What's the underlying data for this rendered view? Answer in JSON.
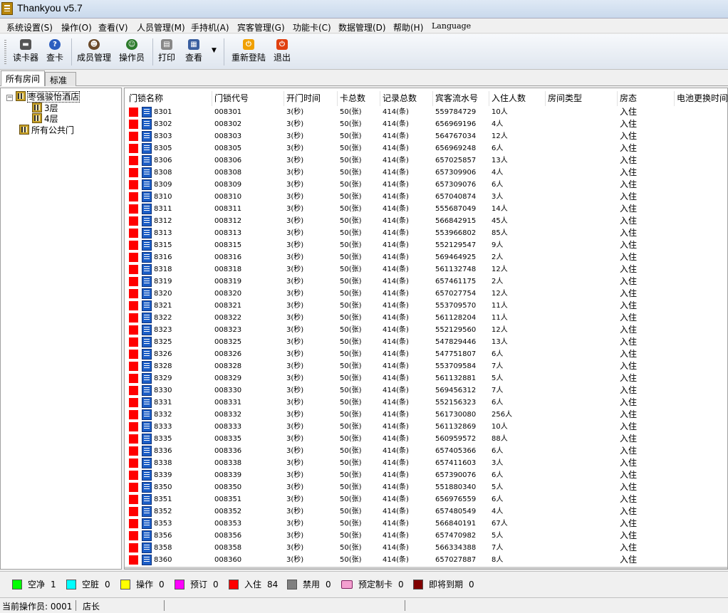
{
  "window": {
    "title": "Thankyou v5.7"
  },
  "menu": [
    "系统设置(S)",
    "操作(O)",
    "查看(V)",
    "人员管理(M)",
    "手持机(A)",
    "宾客管理(G)",
    "功能卡(C)",
    "数据管理(D)",
    "帮助(H)",
    "Language"
  ],
  "toolbar": {
    "read_card": "读卡器",
    "check_card": "查卡",
    "member_mgmt": "成员管理",
    "operator": "操作员",
    "print": "打印",
    "view": "查看",
    "relogin": "重新登陆",
    "exit": "退出"
  },
  "tabs": [
    "所有房间",
    "标准"
  ],
  "tree": {
    "hotel": "枣强骏怡酒店",
    "floor3": "3层",
    "floor4": "4层",
    "public": "所有公共门",
    "toggle": "−"
  },
  "grid": {
    "columns": [
      "门锁名称",
      "门锁代号",
      "开门时间",
      "卡总数",
      "记录总数",
      "宾客流水号",
      "入住人数",
      "房间类型",
      "房态",
      "电池更换时间"
    ],
    "open_time": "3(秒)",
    "card_total": "50(张)",
    "record_total": "414(条)",
    "room_status": "入住",
    "rows": [
      [
        "8301",
        "008301",
        "559784729",
        "10人"
      ],
      [
        "8302",
        "008302",
        "656969196",
        "4人"
      ],
      [
        "8303",
        "008303",
        "564767034",
        "12人"
      ],
      [
        "8305",
        "008305",
        "656969248",
        "6人"
      ],
      [
        "8306",
        "008306",
        "657025857",
        "13人"
      ],
      [
        "8308",
        "008308",
        "657309906",
        "4人"
      ],
      [
        "8309",
        "008309",
        "657309076",
        "6人"
      ],
      [
        "8310",
        "008310",
        "657040874",
        "3人"
      ],
      [
        "8311",
        "008311",
        "555687049",
        "14人"
      ],
      [
        "8312",
        "008312",
        "566842915",
        "45人"
      ],
      [
        "8313",
        "008313",
        "553966802",
        "85人"
      ],
      [
        "8315",
        "008315",
        "552129547",
        "9人"
      ],
      [
        "8316",
        "008316",
        "569464925",
        "2人"
      ],
      [
        "8318",
        "008318",
        "561132748",
        "12人"
      ],
      [
        "8319",
        "008319",
        "657461175",
        "2人"
      ],
      [
        "8320",
        "008320",
        "657027754",
        "12人"
      ],
      [
        "8321",
        "008321",
        "553709570",
        "11人"
      ],
      [
        "8322",
        "008322",
        "561128204",
        "11人"
      ],
      [
        "8323",
        "008323",
        "552129560",
        "12人"
      ],
      [
        "8325",
        "008325",
        "547829446",
        "13人"
      ],
      [
        "8326",
        "008326",
        "547751807",
        "6人"
      ],
      [
        "8328",
        "008328",
        "553709584",
        "7人"
      ],
      [
        "8329",
        "008329",
        "561132881",
        "5人"
      ],
      [
        "8330",
        "008330",
        "569456312",
        "7人"
      ],
      [
        "8331",
        "008331",
        "552156323",
        "6人"
      ],
      [
        "8332",
        "008332",
        "561730080",
        "256人"
      ],
      [
        "8333",
        "008333",
        "561132869",
        "10人"
      ],
      [
        "8335",
        "008335",
        "560959572",
        "88人"
      ],
      [
        "8336",
        "008336",
        "657405366",
        "6人"
      ],
      [
        "8338",
        "008338",
        "657411603",
        "3人"
      ],
      [
        "8339",
        "008339",
        "657390076",
        "6人"
      ],
      [
        "8350",
        "008350",
        "551880340",
        "5人"
      ],
      [
        "8351",
        "008351",
        "656976559",
        "6人"
      ],
      [
        "8352",
        "008352",
        "657480549",
        "4人"
      ],
      [
        "8353",
        "008353",
        "566840191",
        "67人"
      ],
      [
        "8356",
        "008356",
        "657470982",
        "5人"
      ],
      [
        "8358",
        "008358",
        "566334388",
        "7人"
      ],
      [
        "8360",
        "008360",
        "657027887",
        "8人"
      ]
    ]
  },
  "legend": [
    {
      "label": "空净",
      "count": "1",
      "color": "#00ff00"
    },
    {
      "label": "空脏",
      "count": "0",
      "color": "#00ffff"
    },
    {
      "label": "操作",
      "count": "0",
      "color": "#ffff00"
    },
    {
      "label": "预订",
      "count": "0",
      "color": "#ff00ff"
    },
    {
      "label": "入住",
      "count": "84",
      "color": "#ff0000"
    },
    {
      "label": "禁用",
      "count": "0",
      "color": "#808080"
    },
    {
      "label": "预定制卡",
      "count": "0",
      "color": "card"
    },
    {
      "label": "即将到期",
      "count": "0",
      "color": "#800000"
    }
  ],
  "status": {
    "operator": "当前操作员: 0001",
    "role": "店长"
  }
}
